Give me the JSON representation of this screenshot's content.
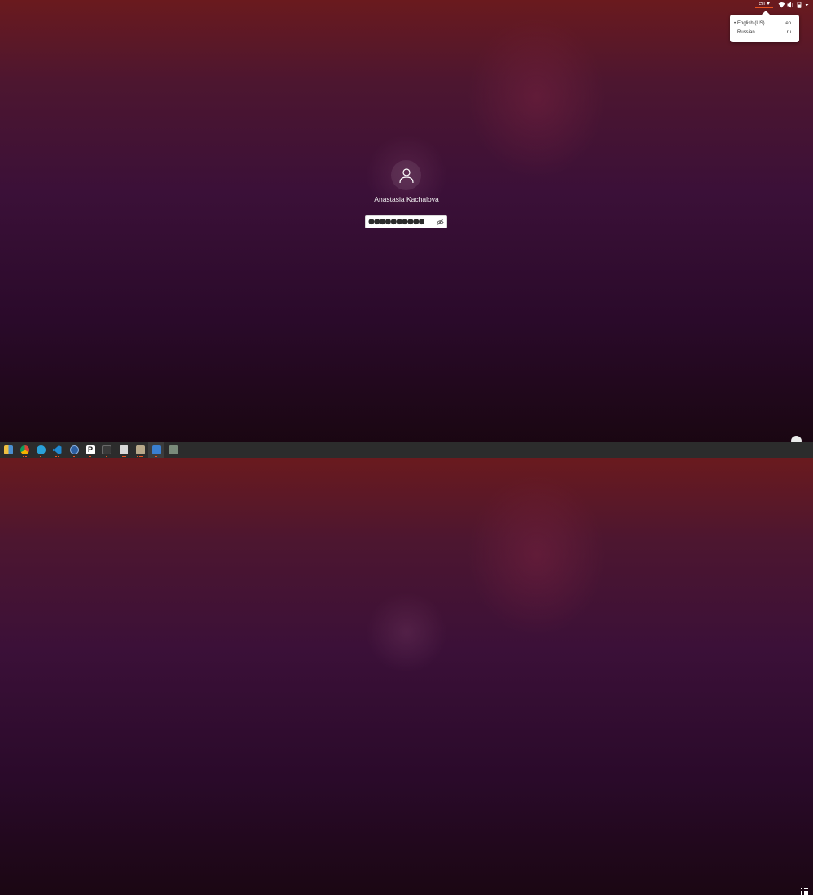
{
  "top_panel": {
    "input_source": "en"
  },
  "language_menu": {
    "items": [
      {
        "selected": true,
        "name": "English (US)",
        "code": "en"
      },
      {
        "selected": false,
        "name": "Russian",
        "code": "ru"
      }
    ]
  },
  "login": {
    "username": "Anastasia Kachalova",
    "password_mask": "●●●●●●●●●●"
  },
  "dock": {
    "apps": [
      "files-icon",
      "chrome-icon",
      "telegram-icon",
      "vscode-icon",
      "app-icon",
      "pycharm-icon",
      "terminal-icon",
      "files-manager-icon",
      "archive-icon",
      "text-editor-icon",
      "trash-icon"
    ]
  },
  "colors": {
    "accent": "#e95420",
    "dock_bg": "#2c2c2c"
  }
}
